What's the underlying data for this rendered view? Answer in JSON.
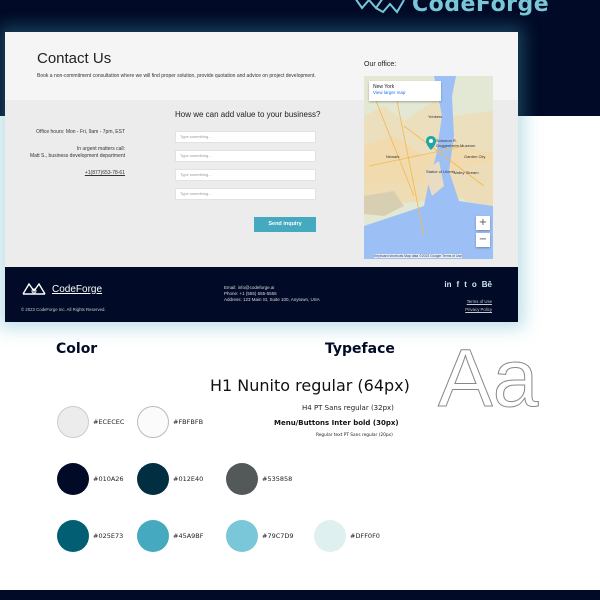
{
  "brand": {
    "name": "CodeForge"
  },
  "contact": {
    "title": "Contact Us",
    "subtitle": "Book a non-commitment consultation where we will find proper solution, provide quotation and advice on project development.",
    "hours": "Office hours: Mon - Fri, 9am - 7pm, EST",
    "urgent": "In urgent matters call:",
    "contact_person": "Matt S., business development department",
    "phone": "+1(877)653-78-61"
  },
  "form": {
    "heading": "How we can add value to your business?",
    "placeholders": [
      "Type something...",
      "Type something...",
      "Type something...",
      "Type something..."
    ],
    "button": "Send inquiry"
  },
  "map": {
    "office_label": "Our office:",
    "city": "New York",
    "view_link": "View larger map",
    "labels": [
      "Yonkers",
      "Newark",
      "Solomon R. Guggenheim Museum",
      "Statue of Liberty",
      "Garden City",
      "Valley Stream"
    ],
    "attribution": "Keyboard shortcuts   Map data ©2023 Google   Terms of Use",
    "zoom_in": "+",
    "zoom_out": "−"
  },
  "footer": {
    "copyright": "© 2023 CodeForge Inc. All Rights Reserved.",
    "email": "Email: info@codeforge.ai",
    "phone": "Phone: +1 (555) 555-5555",
    "address": "Address: 123 Main St, Suite 100, Anytown, USA",
    "social": [
      "in",
      "f",
      "t",
      "o",
      "Bē"
    ],
    "links": [
      "Terms of Use",
      "Privacy Policy"
    ]
  },
  "styleguide": {
    "color_title": "Color",
    "typeface_title": "Typeface",
    "h1_sample": "H1 Nunito regular (64px)",
    "h4_sample": "H4 PT Sans regular (32px)",
    "menu_sample": "Menu/Buttons Inter bold (30px)",
    "regular_sample": "Regular text PT Sans regular (20px)",
    "aa_sample": "Aa",
    "colors": [
      {
        "hex": "#ECECEC"
      },
      {
        "hex": "#FBFBFB"
      },
      {
        "hex": "#010A26"
      },
      {
        "hex": "#012E40"
      },
      {
        "hex": "#535858"
      },
      {
        "hex": "#025E73"
      },
      {
        "hex": "#45A9BF"
      },
      {
        "hex": "#79C7D9"
      },
      {
        "hex": "#DFF0F0"
      }
    ]
  }
}
